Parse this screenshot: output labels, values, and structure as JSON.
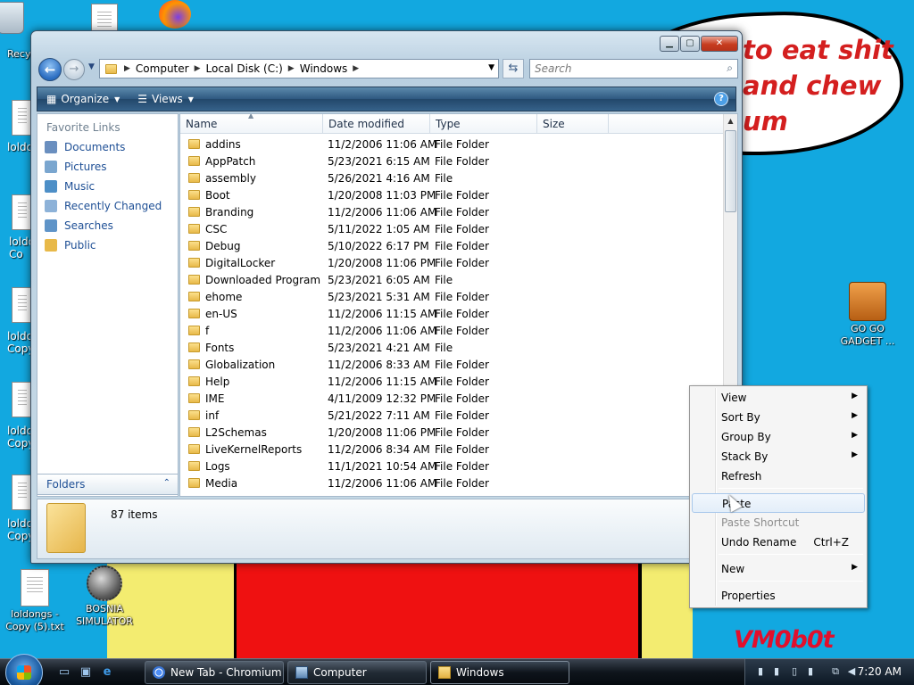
{
  "desktop": {
    "bubble_text": "to eat shit\nand chew\num",
    "signature": "VM0b0t",
    "icons": [
      {
        "label": "Recy"
      },
      {
        "label": "loldo"
      },
      {
        "label": "loldo\nCo"
      },
      {
        "label": "loldo\nCopy"
      },
      {
        "label": "loldo\nCopy"
      },
      {
        "label": "loldo\nCopy"
      },
      {
        "label": "loldongs -\nCopy (5).txt"
      },
      {
        "label": "BOSNIA\nSIMULATOR"
      },
      {
        "label": "GO GO\nGADGET ..."
      }
    ]
  },
  "window": {
    "address": [
      "Computer",
      "Local Disk (C:)",
      "Windows"
    ],
    "search_placeholder": "Search",
    "toolbar": {
      "organize": "Organize",
      "views": "Views",
      "help": "?"
    },
    "favorites_title": "Favorite Links",
    "favorites": [
      {
        "label": "Documents",
        "color": "#6a8fbf"
      },
      {
        "label": "Pictures",
        "color": "#7aa6cf"
      },
      {
        "label": "Music",
        "color": "#4d8fc7"
      },
      {
        "label": "Recently Changed",
        "color": "#8db2d8"
      },
      {
        "label": "Searches",
        "color": "#5f94c8"
      },
      {
        "label": "Public",
        "color": "#e8b949"
      }
    ],
    "folders_label": "Folders",
    "columns": [
      "Name",
      "Date modified",
      "Type",
      "Size"
    ],
    "files": [
      {
        "name": "addins",
        "date": "11/2/2006 11:06 AM",
        "type": "File Folder"
      },
      {
        "name": "AppPatch",
        "date": "5/23/2021 6:15 AM",
        "type": "File Folder"
      },
      {
        "name": "assembly",
        "date": "5/26/2021 4:16 AM",
        "type": "File"
      },
      {
        "name": "Boot",
        "date": "1/20/2008 11:03 PM",
        "type": "File Folder"
      },
      {
        "name": "Branding",
        "date": "11/2/2006 11:06 AM",
        "type": "File Folder"
      },
      {
        "name": "CSC",
        "date": "5/11/2022 1:05 AM",
        "type": "File Folder"
      },
      {
        "name": "Debug",
        "date": "5/10/2022 6:17 PM",
        "type": "File Folder"
      },
      {
        "name": "DigitalLocker",
        "date": "1/20/2008 11:06 PM",
        "type": "File Folder"
      },
      {
        "name": "Downloaded Program ...",
        "date": "5/23/2021 6:05 AM",
        "type": "File"
      },
      {
        "name": "ehome",
        "date": "5/23/2021 5:31 AM",
        "type": "File Folder"
      },
      {
        "name": "en-US",
        "date": "11/2/2006 11:15 AM",
        "type": "File Folder"
      },
      {
        "name": "f",
        "date": "11/2/2006 11:06 AM",
        "type": "File Folder"
      },
      {
        "name": "Fonts",
        "date": "5/23/2021 4:21 AM",
        "type": "File"
      },
      {
        "name": "Globalization",
        "date": "11/2/2006 8:33 AM",
        "type": "File Folder"
      },
      {
        "name": "Help",
        "date": "11/2/2006 11:15 AM",
        "type": "File Folder"
      },
      {
        "name": "IME",
        "date": "4/11/2009 12:32 PM",
        "type": "File Folder"
      },
      {
        "name": "inf",
        "date": "5/21/2022 7:11 AM",
        "type": "File Folder"
      },
      {
        "name": "L2Schemas",
        "date": "1/20/2008 11:06 PM",
        "type": "File Folder"
      },
      {
        "name": "LiveKernelReports",
        "date": "11/2/2006 8:34 AM",
        "type": "File Folder"
      },
      {
        "name": "Logs",
        "date": "11/1/2021 10:54 AM",
        "type": "File Folder"
      },
      {
        "name": "Media",
        "date": "11/2/2006 11:06 AM",
        "type": "File Folder"
      }
    ],
    "item_count": "87 items"
  },
  "context_menu": {
    "items": [
      {
        "label": "View",
        "submenu": true
      },
      {
        "label": "Sort By",
        "submenu": true
      },
      {
        "label": "Group By",
        "submenu": true
      },
      {
        "label": "Stack By",
        "submenu": true
      },
      {
        "label": "Refresh"
      },
      {
        "label": "Paste"
      },
      {
        "label": "Paste Shortcut",
        "disabled": true
      },
      {
        "label": "Undo Rename",
        "shortcut": "Ctrl+Z"
      },
      {
        "label": "New",
        "submenu": true
      },
      {
        "label": "Properties"
      }
    ]
  },
  "taskbar": {
    "tasks": [
      "New Tab - Chromium",
      "Computer",
      "Windows"
    ],
    "clock": "7:20 AM"
  }
}
